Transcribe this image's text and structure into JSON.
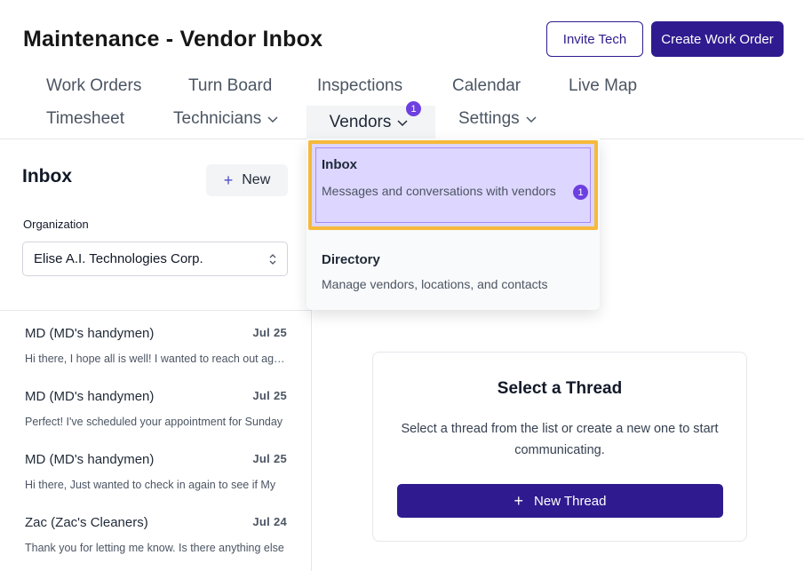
{
  "header": {
    "title": "Maintenance - Vendor Inbox",
    "invite_label": "Invite Tech",
    "create_label": "Create Work Order"
  },
  "nav": {
    "work_orders": "Work Orders",
    "turn_board": "Turn Board",
    "inspections": "Inspections",
    "calendar": "Calendar",
    "live_map": "Live Map",
    "timesheet": "Timesheet",
    "technicians": "Technicians",
    "vendors": "Vendors",
    "vendors_badge": "1",
    "settings": "Settings"
  },
  "vendors_menu": {
    "inbox_title": "Inbox",
    "inbox_desc": "Messages and conversations with vendors",
    "inbox_badge": "1",
    "directory_title": "Directory",
    "directory_desc": "Manage vendors, locations, and contacts"
  },
  "sidebar": {
    "title": "Inbox",
    "new_label": "New",
    "org_label": "Organization",
    "org_value": "Elise A.I. Technologies Corp."
  },
  "threads": [
    {
      "name": "MD (MD's handymen)",
      "date": "Jul 25",
      "preview": "Hi there, I hope all is well! I wanted to reach out again"
    },
    {
      "name": "MD (MD's handymen)",
      "date": "Jul 25",
      "preview": "Perfect! I've scheduled your appointment for Sunday"
    },
    {
      "name": "MD (MD's handymen)",
      "date": "Jul 25",
      "preview": "Hi there, Just wanted to check in again to see if My"
    },
    {
      "name": "Zac (Zac's Cleaners)",
      "date": "Jul 24",
      "preview": "Thank you for letting me know. Is there anything else"
    }
  ],
  "empty_state": {
    "title": "Select a Thread",
    "text": "Select a thread from the list or create a new one to start communicating.",
    "button_label": "New Thread"
  },
  "colors": {
    "primary": "#2f1b8f",
    "badge": "#6d3fe0",
    "highlight_border": "#f6b93b",
    "highlight_bg": "#ddd6fe"
  }
}
